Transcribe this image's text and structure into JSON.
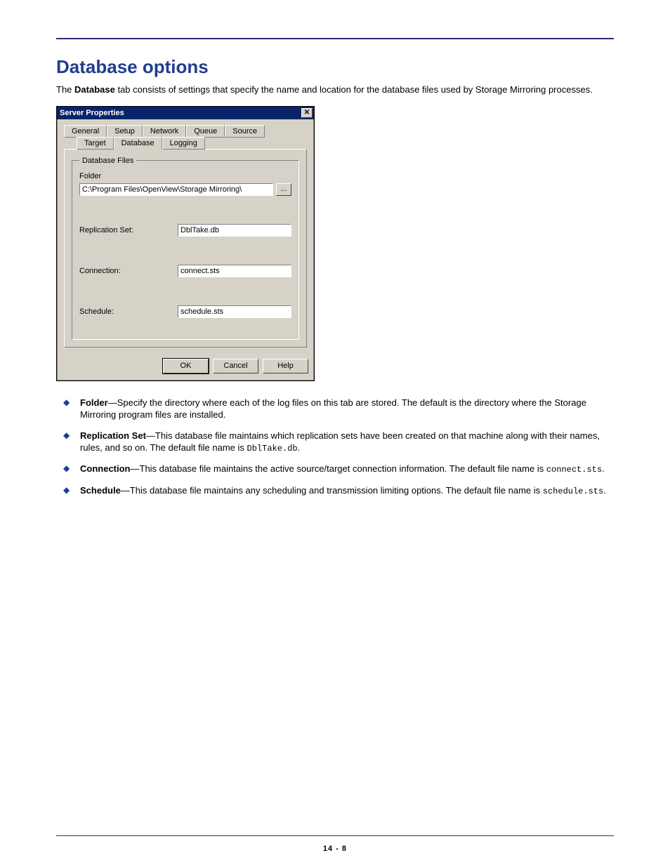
{
  "page": {
    "title": "Database options",
    "intro_prefix": "The ",
    "intro_bold": "Database",
    "intro_suffix": " tab consists of settings that specify the name and location for the database files used by Storage Mirroring processes.",
    "footer": "14 - 8"
  },
  "dialog": {
    "title": "Server Properties",
    "close_label": "✕",
    "tabs_row1": [
      "General",
      "Setup",
      "Network",
      "Queue",
      "Source"
    ],
    "tabs_row2": [
      "Target",
      "Database",
      "Logging"
    ],
    "active_tab": "Database",
    "group_legend": "Database Files",
    "folder_label": "Folder",
    "folder_value": "C:\\Program Files\\OpenView\\Storage Mirroring\\",
    "browse_label": "...",
    "repset_label": "Replication Set:",
    "repset_value": "DblTake.db",
    "conn_label": "Connection:",
    "conn_value": "connect.sts",
    "sched_label": "Schedule:",
    "sched_value": "schedule.sts",
    "ok": "OK",
    "cancel": "Cancel",
    "help": "Help"
  },
  "bullets": {
    "folder_bold": "Folder",
    "folder_text": "—Specify the directory where each of the log files on this tab are stored. The default is the directory where the Storage Mirroring program files are installed.",
    "repset_bold": "Replication Set",
    "repset_text": "—This database file maintains which replication sets have been created on that machine along with their names, rules, and so on. The default file name is ",
    "repset_code": "DblTake.db",
    "conn_bold": "Connection",
    "conn_text": "—This database file maintains the active source/target connection information. The default file name is ",
    "conn_code": "connect.sts",
    "sched_bold": "Schedule",
    "sched_text": "—This database file maintains any scheduling and transmission limiting options. The default file name is ",
    "sched_code": "schedule.sts",
    "period": "."
  }
}
